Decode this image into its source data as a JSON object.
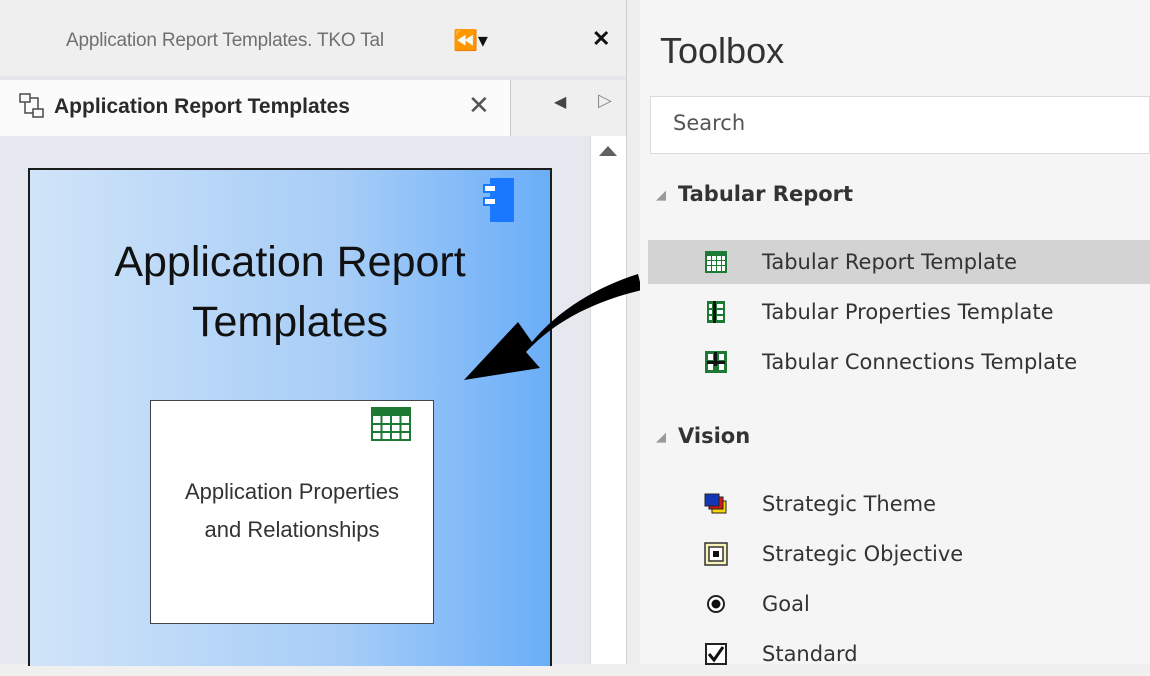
{
  "left_pane": {
    "header": {
      "title": "Application Report Templates.  TKO Tal",
      "controls": "⏪▾",
      "close": "✕"
    },
    "doc_tab": {
      "label": "Application Report Templates",
      "close": "✕",
      "nav_left": "◀",
      "nav_right": "▷"
    },
    "package": {
      "title_line1": "Application Report",
      "title_line2": "Templates",
      "report_element": {
        "label_line1": "Application Properties",
        "label_line2": "and Relationships"
      }
    }
  },
  "toolbox": {
    "title": "Toolbox",
    "search_placeholder": "Search",
    "groups": [
      {
        "name": "Tabular Report",
        "items": [
          {
            "label": "Tabular Report Template",
            "icon": "table-grid-icon",
            "selected": true
          },
          {
            "label": "Tabular Properties Template",
            "icon": "properties-grid-icon",
            "selected": false
          },
          {
            "label": "Tabular Connections Template",
            "icon": "connections-grid-icon",
            "selected": false
          }
        ]
      },
      {
        "name": "Vision",
        "items": [
          {
            "label": "Strategic Theme",
            "icon": "strategic-theme-icon"
          },
          {
            "label": "Strategic Objective",
            "icon": "strategic-objective-icon"
          },
          {
            "label": "Goal",
            "icon": "goal-icon"
          },
          {
            "label": "Standard",
            "icon": "checkbox-icon"
          }
        ]
      }
    ]
  },
  "colors": {
    "package_gradient_start": "#d0e4f8",
    "package_gradient_end": "#6aaef8",
    "component_icon_blue": "#1a78ff",
    "table_icon_green": "#1d7a34",
    "selection_gray": "#d3d3d3"
  }
}
